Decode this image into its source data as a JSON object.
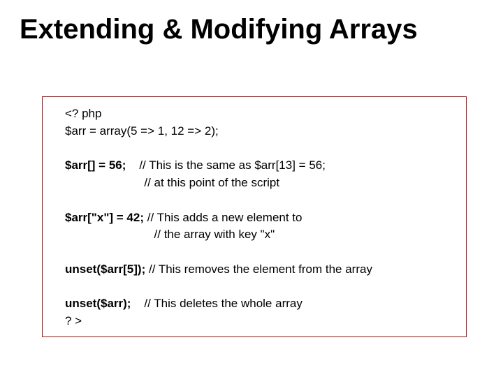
{
  "title": "Extending & Modifying Arrays",
  "code": {
    "l1": "<? php",
    "l2": "$arr = array(5 => 1, 12 => 2);",
    "l3_lead": "$arr[] = 56;",
    "l3_pad": "    ",
    "l3_c1": "// This is the same as $arr[13] = 56;",
    "l3_c2_pad": "                        ",
    "l3_c2": "// at this point of the script",
    "l4_lead": "$arr[\"x\"] = 42; ",
    "l4_c1": "// This adds a new element to",
    "l4_c2_pad": "                           ",
    "l4_c2": "// the array with key \"x\"",
    "l5_lead": "unset($arr[5]); ",
    "l5_c1": "// This removes the element from the array",
    "l6_lead": "unset($arr);",
    "l6_pad": "    ",
    "l6_c1": "// This deletes the whole array",
    "l7": "? >"
  }
}
